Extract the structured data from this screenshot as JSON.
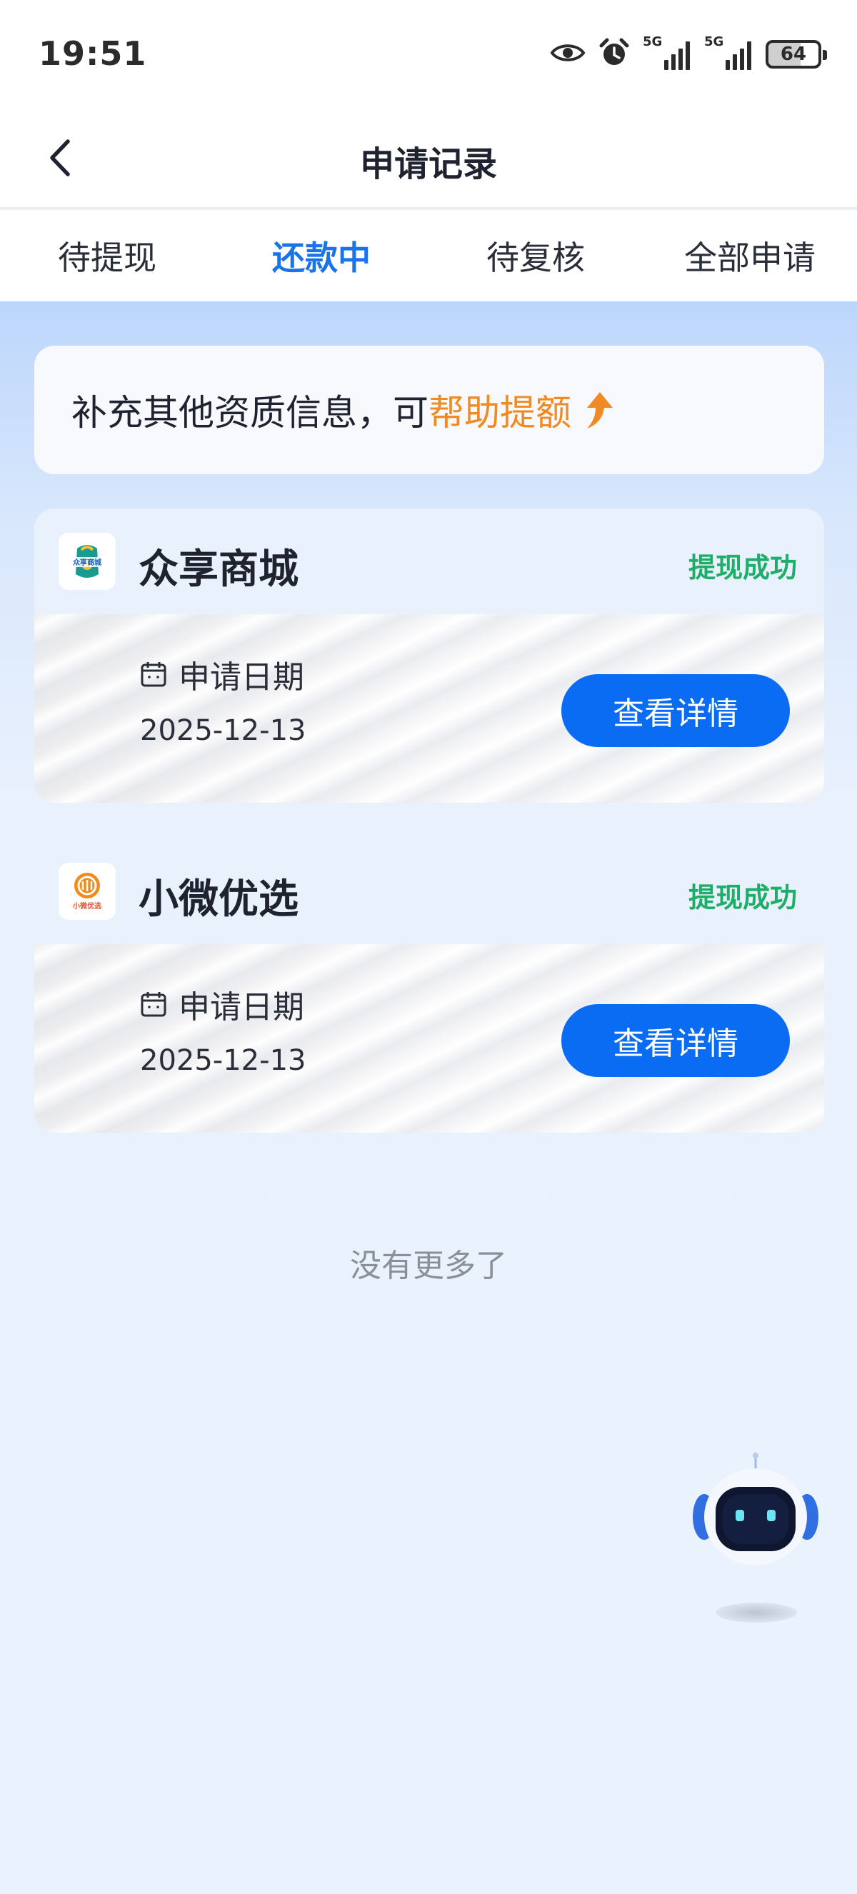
{
  "status_bar": {
    "time": "19:51",
    "network_1": "5G",
    "network_2": "5G",
    "battery": "64",
    "icons": [
      "eye-icon",
      "alarm-icon",
      "signal-icon",
      "signal-icon",
      "battery-icon"
    ]
  },
  "header": {
    "title": "申请记录",
    "back_icon": "chevron-left-icon"
  },
  "tabs": [
    {
      "label": "待提现",
      "active": false
    },
    {
      "label": "还款中",
      "active": true
    },
    {
      "label": "待复核",
      "active": false
    },
    {
      "label": "全部申请",
      "active": false
    }
  ],
  "promo": {
    "text": "补充其他资质信息，可",
    "highlight": "帮助提额",
    "icon": "arrow-up-icon"
  },
  "records": [
    {
      "name": "众享商城",
      "logo_text": "众享商城",
      "status": "提现成功",
      "date_label": "申请日期",
      "date": "2025-12-13",
      "button": "查看详情"
    },
    {
      "name": "小微优选",
      "logo_text": "小微优选",
      "status": "提现成功",
      "date_label": "申请日期",
      "date": "2025-12-13",
      "button": "查看详情"
    }
  ],
  "footer": {
    "no_more": "没有更多了"
  },
  "assistant": {
    "icon": "robot-assistant-icon"
  },
  "colors": {
    "accent_blue": "#1a73e8",
    "button_blue": "#0a6cf2",
    "promo_orange": "#f08a24",
    "status_green": "#1fae6a"
  }
}
